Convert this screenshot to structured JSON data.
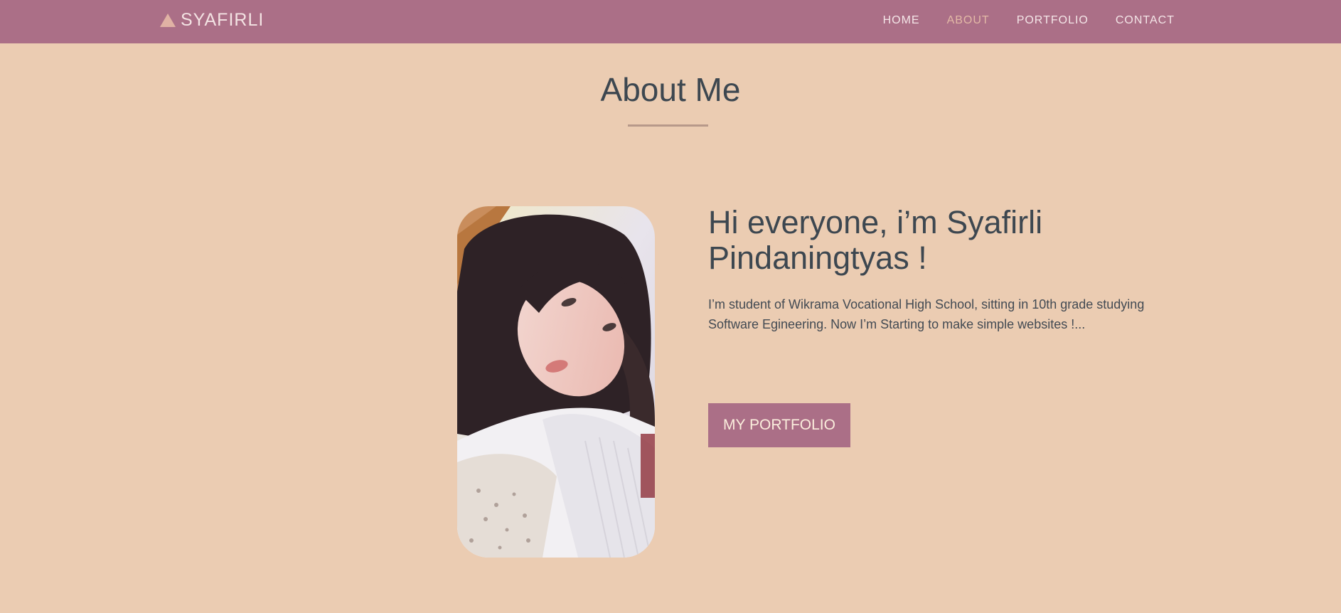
{
  "header": {
    "brand": "SYAFIRLI",
    "nav": [
      {
        "label": "HOME",
        "active": false
      },
      {
        "label": "ABOUT",
        "active": true
      },
      {
        "label": "PORTFOLIO",
        "active": false
      },
      {
        "label": "CONTACT",
        "active": false
      }
    ]
  },
  "about": {
    "title": "About Me",
    "greeting": "Hi everyone, i’m Syafirli Pindaningtyas !",
    "bio": "I’m student of Wikrama Vocational High School, sitting in 10th grade studying Software Egineering. Now I’m Starting to make simple websites !...",
    "cta_label": "MY PORTFOLIO"
  },
  "colors": {
    "background": "#ebccb2",
    "navbar": "#ab6f87",
    "nav_active": "#e3b9a6",
    "text": "#3d4750",
    "button": "#ab6f87"
  }
}
